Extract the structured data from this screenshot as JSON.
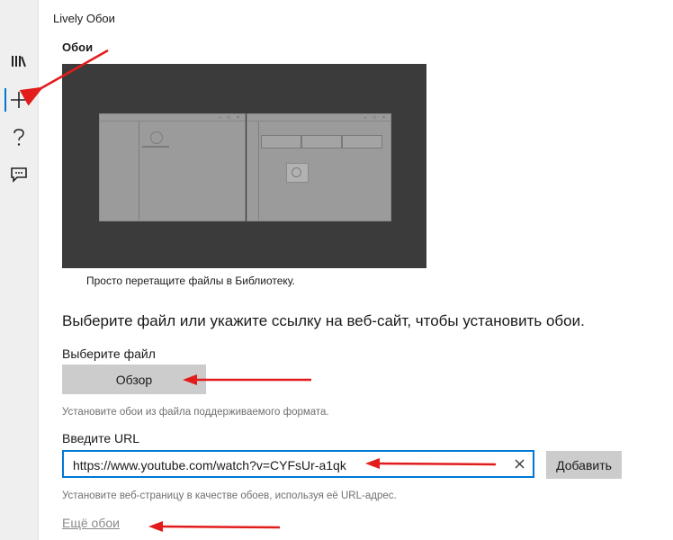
{
  "window": {
    "title": "Lively Обои"
  },
  "sidebar": {
    "items": [
      {
        "icon": "library-icon"
      },
      {
        "icon": "add-icon",
        "selected": true
      },
      {
        "icon": "help-icon"
      },
      {
        "icon": "feedback-icon"
      }
    ],
    "accent": "#0078d4"
  },
  "wallpaper_section": {
    "heading": "Обои",
    "drop_caption": "Просто перетащите файлы в Библиотеку."
  },
  "main": {
    "heading": "Выберите файл или укажите ссылку на веб-сайт, чтобы установить обои.",
    "file": {
      "label": "Выберите файл",
      "button": "Обзор",
      "hint": "Установите обои из файла поддерживаемого формата."
    },
    "url": {
      "label": "Введите URL",
      "value": "https://www.youtube.com/watch?v=CYFsUr-a1qk",
      "add_button": "Добавить",
      "hint": "Установите веб-страницу в качестве обоев, используя её URL-адрес."
    },
    "more_link": "Ещё обои"
  },
  "colors": {
    "arrow": "#e21b1b",
    "accent": "#0078d4"
  }
}
